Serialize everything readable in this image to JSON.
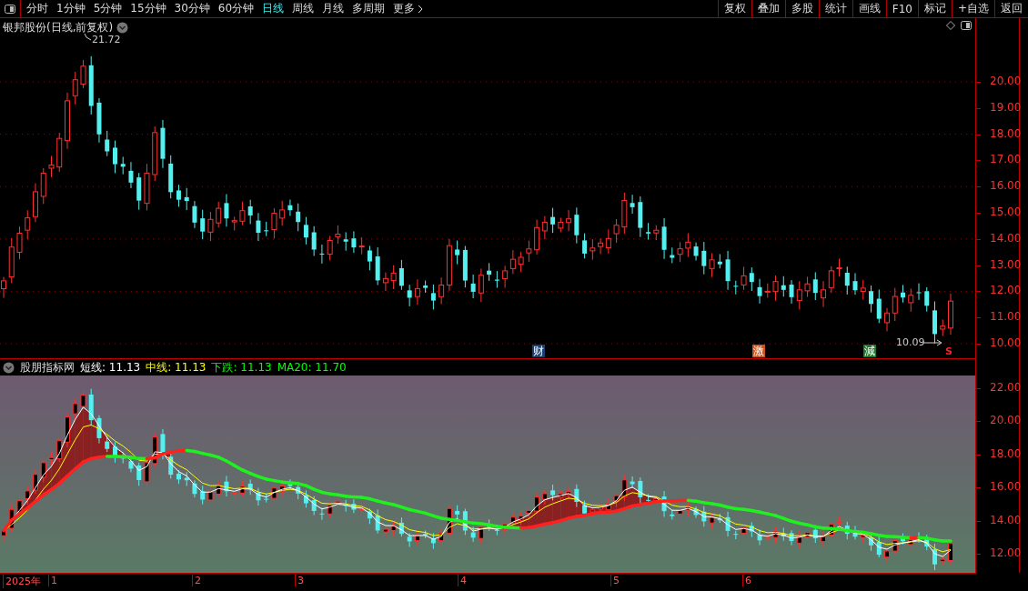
{
  "toolbar": {
    "periods": [
      {
        "label": "分时",
        "selected": false
      },
      {
        "label": "1分钟",
        "selected": false
      },
      {
        "label": "5分钟",
        "selected": false
      },
      {
        "label": "15分钟",
        "selected": false
      },
      {
        "label": "30分钟",
        "selected": false
      },
      {
        "label": "60分钟",
        "selected": false
      },
      {
        "label": "日线",
        "selected": true
      },
      {
        "label": "周线",
        "selected": false
      },
      {
        "label": "月线",
        "selected": false
      },
      {
        "label": "多周期",
        "selected": false
      }
    ],
    "more": "更多",
    "buttons": [
      "复权",
      "叠加",
      "多股",
      "统计",
      "画线",
      "F10",
      "标记",
      "+自选",
      "返回"
    ]
  },
  "chart": {
    "title": "银邦股份(日线,前复权)",
    "high_label": "21.72",
    "low_label": "10.09",
    "y_axis": [
      "20.00",
      "19.00",
      "18.00",
      "17.00",
      "16.00",
      "15.00",
      "14.00",
      "13.00",
      "12.00",
      "11.00",
      "10.00"
    ],
    "markers": [
      {
        "text": "财",
        "color": "#1a3f6e"
      },
      {
        "text": "激",
        "color": "#c8561e"
      },
      {
        "text": "減",
        "color": "#1e7a2a"
      }
    ],
    "signal": "S"
  },
  "indicator": {
    "name": "股朋指标网",
    "values": [
      {
        "label": "短线:",
        "value": "11.13",
        "color": "#ffffff"
      },
      {
        "label": "中线:",
        "value": "11.13",
        "color": "#ffff00"
      },
      {
        "label": "下跌:",
        "value": "11.13",
        "color": "#00ff00"
      },
      {
        "label": "MA20:",
        "value": "11.70",
        "color": "#00ff00"
      }
    ],
    "y_axis": [
      "22.00",
      "20.00",
      "18.00",
      "16.00",
      "14.00",
      "12.00"
    ]
  },
  "date_axis": {
    "labels": [
      "2025年",
      "1",
      "2",
      "3",
      "4",
      "5",
      "6"
    ]
  }
}
